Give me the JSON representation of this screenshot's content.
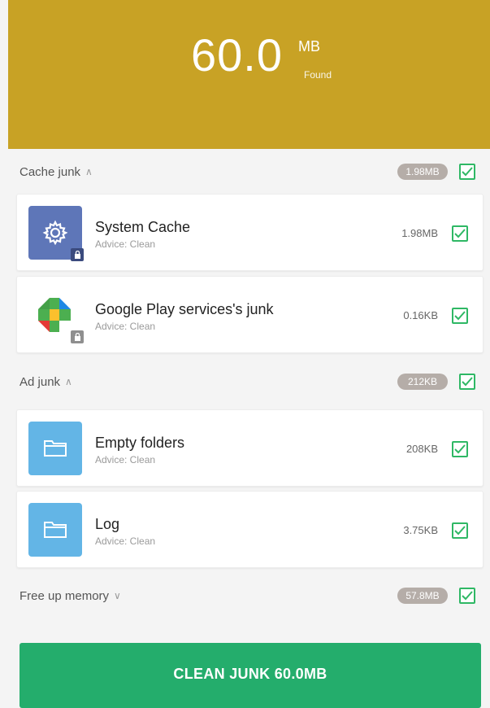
{
  "header": {
    "amount": "60.0",
    "unit": "MB",
    "found_label": "Found",
    "background": "#c8a225"
  },
  "sections": [
    {
      "label": "Cache junk",
      "badge": "1.98MB",
      "expanded": true,
      "checked": true,
      "items": [
        {
          "name": "System Cache",
          "advice": "Advice: Clean",
          "size": "1.98MB",
          "icon": "system-cache-gear-icon",
          "checked": true
        },
        {
          "name": "Google Play services's junk",
          "advice": "Advice: Clean",
          "size": "0.16KB",
          "icon": "google-play-services-icon",
          "checked": true
        }
      ]
    },
    {
      "label": "Ad junk",
      "badge": "212KB",
      "expanded": true,
      "checked": true,
      "items": [
        {
          "name": "Empty folders",
          "advice": "Advice: Clean",
          "size": "208KB",
          "icon": "folder-icon",
          "checked": true
        },
        {
          "name": "Log",
          "advice": "Advice: Clean",
          "size": "3.75KB",
          "icon": "folder-icon",
          "checked": true
        }
      ]
    },
    {
      "label": "Free up memory",
      "badge": "57.8MB",
      "expanded": false,
      "checked": true,
      "items": []
    }
  ],
  "clean_button": {
    "label": "CLEAN JUNK 60.0MB",
    "color": "#24ad6c"
  },
  "accent_check_color": "#2fb865"
}
